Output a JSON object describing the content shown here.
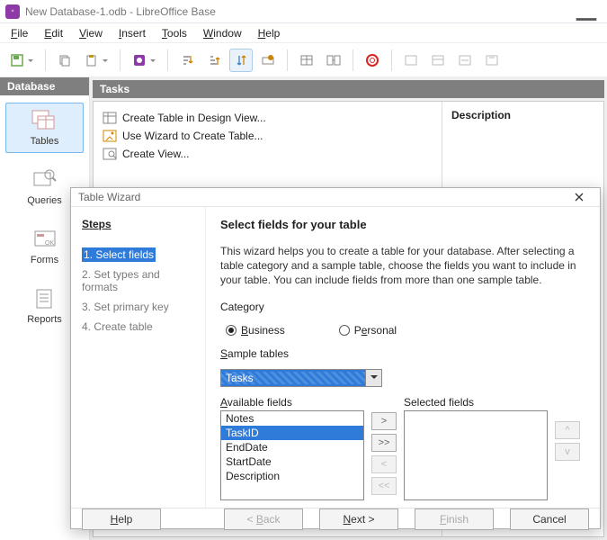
{
  "window": {
    "title": "New Database-1.odb - LibreOffice Base"
  },
  "menu": {
    "file": "File",
    "edit": "Edit",
    "view": "View",
    "insert": "Insert",
    "tools": "Tools",
    "window": "Window",
    "help": "Help"
  },
  "sidepanel": {
    "header": "Database",
    "tables": "Tables",
    "queries": "Queries",
    "forms": "Forms",
    "reports": "Reports"
  },
  "tasks": {
    "header": "Tasks",
    "create_design": "Create Table in Design View...",
    "use_wizard": "Use Wizard to Create Table...",
    "create_view": "Create View...",
    "description_label": "Description"
  },
  "dialog": {
    "title": "Table Wizard",
    "steps_title": "Steps",
    "steps": {
      "s1": "1. Select fields",
      "s2": "2. Set types and formats",
      "s3": "3. Set primary key",
      "s4": "4. Create table"
    },
    "heading": "Select fields for your table",
    "intro": "This wizard helps you to create a table for your database. After selecting a table category and a sample table, choose the fields you want to include in your table. You can include fields from more than one sample table.",
    "category_label": "Category",
    "radio_business": "Business",
    "radio_personal": "Personal",
    "sample_tables_label": "Sample tables",
    "sample_tables_value": "Tasks",
    "available_label": "Available fields",
    "selected_label": "Selected fields",
    "available": [
      "Notes",
      "TaskID",
      "EndDate",
      "StartDate",
      "Description"
    ],
    "available_selected_index": 1,
    "move": {
      "add": ">",
      "add_all": ">>",
      "remove": "<",
      "remove_all": "<<",
      "up": "^",
      "down": "v"
    },
    "buttons": {
      "help": "Help",
      "back": "< Back",
      "next": "Next >",
      "finish": "Finish",
      "cancel": "Cancel"
    }
  }
}
